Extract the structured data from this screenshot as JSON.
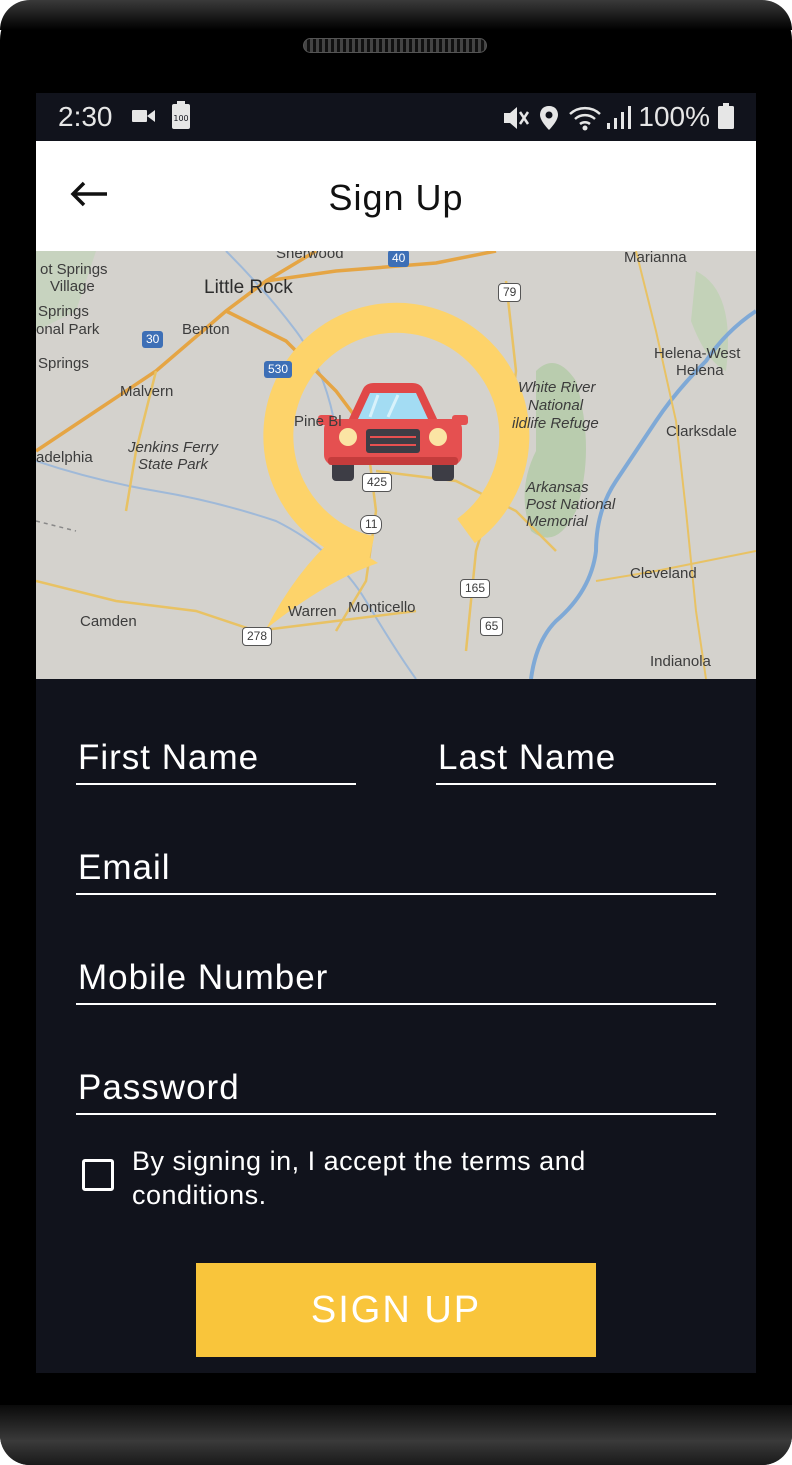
{
  "status_bar": {
    "time": "2:30",
    "battery_percent": "100%",
    "battery_badge": "100",
    "icons": [
      "video-camera-icon",
      "battery-saver-icon",
      "mute-icon",
      "location-icon",
      "wifi-icon",
      "signal-icon",
      "battery-icon"
    ]
  },
  "app_bar": {
    "title": "Sign Up",
    "back_icon": "arrow-left-icon"
  },
  "map": {
    "labels": [
      "ot Springs",
      "Village",
      "Springs",
      "onal Park",
      "Springs",
      "Little Rock",
      "Benton",
      "Malvern",
      "Jenkins Ferry",
      "State Park",
      "adelphia",
      "Pine Bl",
      "Camden",
      "Warren",
      "Monticello",
      "White River",
      "National",
      "ildlife Refuge",
      "Arkansas",
      "Post National",
      "Memorial",
      "Helena-West",
      "Helena",
      "Clarksdale",
      "Cleveland",
      "Indianola",
      "Marianna",
      "Sherwood"
    ],
    "route_shields": [
      "40",
      "79",
      "30",
      "530",
      "425",
      "11",
      "165",
      "65",
      "278"
    ],
    "logo_colors": {
      "ring": "#fdd36a",
      "car_body": "#e55050",
      "window": "#9fd9f2"
    }
  },
  "form": {
    "first_name_placeholder": "First Name",
    "last_name_placeholder": "Last Name",
    "email_placeholder": "Email",
    "mobile_placeholder": "Mobile Number",
    "password_placeholder": "Password",
    "terms_text": "By signing in, I accept the terms and conditions.",
    "terms_checked": false,
    "submit_label": "SIGN UP"
  },
  "colors": {
    "screen_background": "#11131c",
    "accent": "#f9c53b",
    "app_bar": "#ffffff"
  }
}
